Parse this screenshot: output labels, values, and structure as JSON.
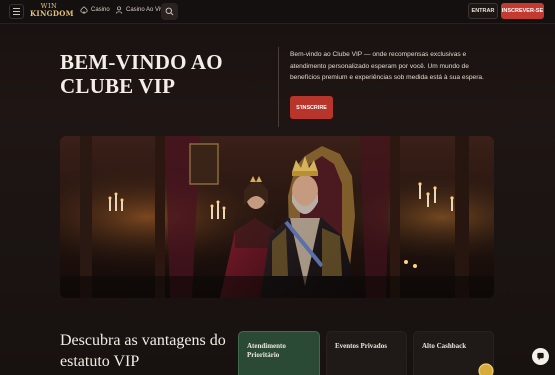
{
  "header": {
    "logo_line1": "WIN",
    "logo_line2": "KINGDOM",
    "nav": [
      {
        "label": "Casino",
        "icon": "spade-icon"
      },
      {
        "label": "Casino Ao Vivo",
        "icon": "dealer-icon"
      }
    ],
    "login_label": "ENTRAR",
    "signup_label": "INSCREVER-SE"
  },
  "hero": {
    "title": "BEM-VINDO AO CLUBE VIP",
    "description": "Bem-vindo ao Clube VIP — onde recompensas exclusivas e atendimento personalizado esperam por você. Um mundo de benefícios premium e experiências sob medida está à sua espera.",
    "cta_label": "S'INSCRIRE"
  },
  "benefits": {
    "title": "Descubra as vantagens do estatuto VIP",
    "cards": [
      {
        "label": "Atendimento Prioritário"
      },
      {
        "label": "Eventos Privados"
      },
      {
        "label": "Alto Cashback"
      }
    ]
  },
  "colors": {
    "accent": "#c33a30",
    "card_active": "#2b4a36",
    "gold": "#e6c27a"
  }
}
